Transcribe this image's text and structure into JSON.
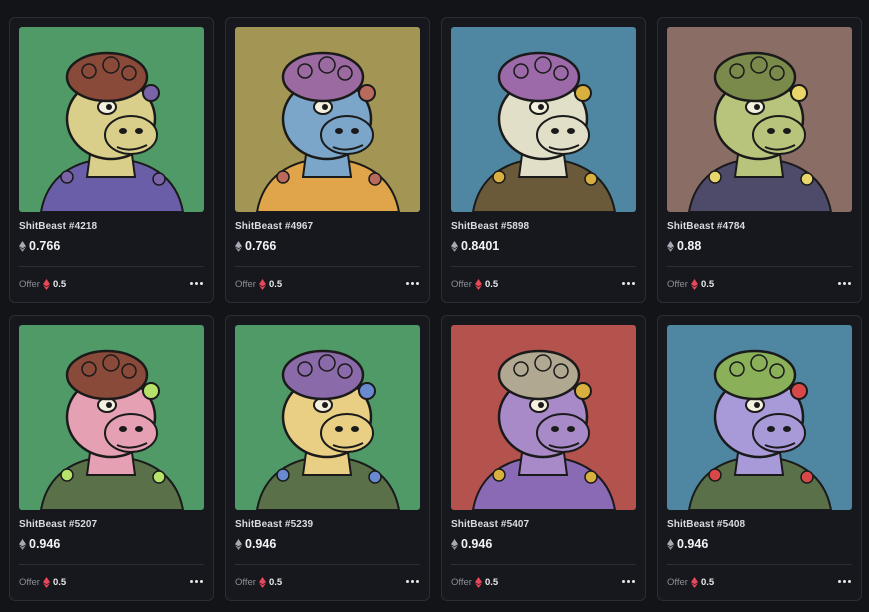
{
  "currency": {
    "eth_icon": "eth-diamond-icon",
    "weth_icon": "weth-diamond-icon",
    "weth_color": "#e8485a"
  },
  "offer_label": "Offer",
  "cards": [
    {
      "name": "ShitBeast #4218",
      "price": "0.766",
      "offer": "0.5",
      "bg": "#4f9a66",
      "skin": "#d9cf8a",
      "hair": "#8a4a3a",
      "body": "#6b5ea8",
      "accent": "#7b63a8"
    },
    {
      "name": "ShitBeast #4967",
      "price": "0.766",
      "offer": "0.5",
      "bg": "#a39654",
      "skin": "#7ca6c9",
      "hair": "#9a6aa0",
      "body": "#e0a44a",
      "accent": "#b86a5c"
    },
    {
      "name": "ShitBeast #5898",
      "price": "0.8401",
      "offer": "0.5",
      "bg": "#4f87a2",
      "skin": "#e2dfc8",
      "hair": "#9c6aa8",
      "body": "#6a5a3a",
      "accent": "#d8b040"
    },
    {
      "name": "ShitBeast #4784",
      "price": "0.88",
      "offer": "0.5",
      "bg": "#8a6e66",
      "skin": "#b8c47c",
      "hair": "#7a8a4a",
      "body": "#4e4a6a",
      "accent": "#e8d66a"
    },
    {
      "name": "ShitBeast #5207",
      "price": "0.946",
      "offer": "0.5",
      "bg": "#4f9a66",
      "skin": "#e5a0b4",
      "hair": "#8a4a3a",
      "body": "#5a7048",
      "accent": "#b6e26a"
    },
    {
      "name": "ShitBeast #5239",
      "price": "0.946",
      "offer": "0.5",
      "bg": "#4f9a66",
      "skin": "#e8cf84",
      "hair": "#8a6aa8",
      "body": "#5a7048",
      "accent": "#6a8ad0"
    },
    {
      "name": "ShitBeast #5407",
      "price": "0.946",
      "offer": "0.5",
      "bg": "#b4524e",
      "skin": "#a88ac8",
      "hair": "#b0a890",
      "body": "#8a6ab4",
      "accent": "#d8b040"
    },
    {
      "name": "ShitBeast #5408",
      "price": "0.946",
      "offer": "0.5",
      "bg": "#4f87a2",
      "skin": "#a89ad8",
      "hair": "#8ab05a",
      "body": "#5a7048",
      "accent": "#d84848"
    }
  ]
}
